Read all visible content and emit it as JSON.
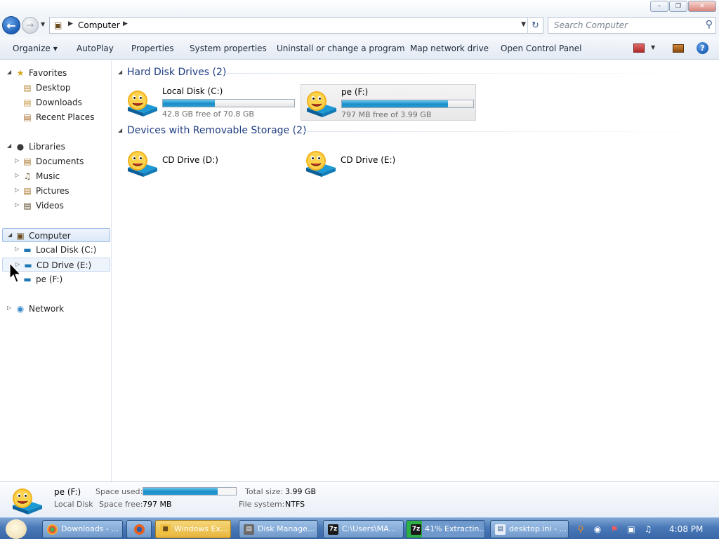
{
  "window": {
    "minimize_icon": "minimize-icon",
    "maximize_icon": "maximize-icon",
    "close_icon": "close-icon"
  },
  "address_bar": {
    "path": "Computer",
    "back_icon": "back-arrow-icon",
    "forward_icon": "forward-arrow-icon",
    "refresh_icon": "refresh-icon"
  },
  "search": {
    "placeholder": "Search Computer",
    "icon": "search-icon"
  },
  "toolbar": {
    "organize": "Organize",
    "autoplay": "AutoPlay",
    "properties": "Properties",
    "system_properties": "System properties",
    "uninstall": "Uninstall or change a program",
    "map_network": "Map network drive",
    "control_panel": "Open Control Panel"
  },
  "nav": {
    "favorites": "Favorites",
    "desktop": "Desktop",
    "downloads": "Downloads",
    "recent_places": "Recent Places",
    "libraries": "Libraries",
    "documents": "Documents",
    "music": "Music",
    "pictures": "Pictures",
    "videos": "Videos",
    "computer": "Computer",
    "local_disk_c": "Local Disk (C:)",
    "cd_drive_e": "CD Drive (E:)",
    "pe_f": "pe (F:)",
    "network": "Network"
  },
  "groups": {
    "hard_disks": "Hard Disk Drives (2)",
    "removable": "Devices with Removable Storage (2)"
  },
  "drives": [
    {
      "name": "Local Disk (C:)",
      "free": "42.8 GB free of 70.8 GB",
      "used_fraction": 0.3955
    },
    {
      "name": "pe (F:)",
      "free": "797 MB free of 3.99 GB",
      "used_fraction": 0.805
    },
    {
      "name": "CD Drive (D:)"
    },
    {
      "name": "CD Drive (E:)"
    }
  ],
  "details": {
    "name": "pe (F:)",
    "type": "Local Disk",
    "space_used_label": "Space used:",
    "space_free_label": "Space free:",
    "space_free": "797 MB",
    "total_size_label": "Total size:",
    "total_size": "3.99 GB",
    "file_system_label": "File system:",
    "file_system": "NTFS",
    "used_fraction": 0.805
  },
  "taskbar": {
    "tasks": [
      {
        "label": "Downloads - ..."
      },
      {
        "label": "Windows Ex..."
      },
      {
        "label": "Disk Manage..."
      },
      {
        "label": "C:\\Users\\MA..."
      },
      {
        "label": "41% Extractin..."
      },
      {
        "label": "desktop.ini - ..."
      }
    ],
    "clock": "4:08 PM"
  }
}
